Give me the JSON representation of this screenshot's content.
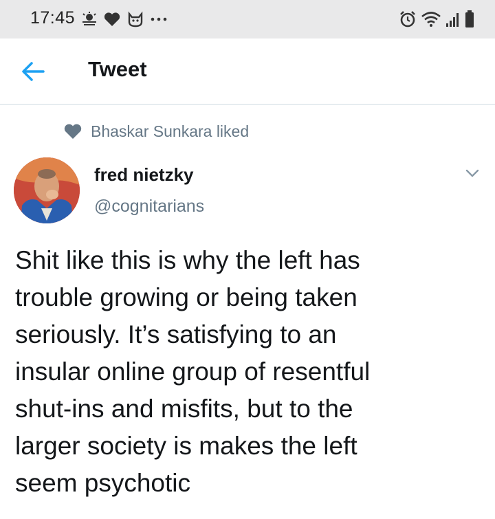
{
  "status_bar": {
    "time": "17:45",
    "icons_left": [
      "weather-icon",
      "heart-icon",
      "cat-icon",
      "more-dots-icon"
    ],
    "icons_right": [
      "alarm-icon",
      "wifi-icon",
      "signal-icon",
      "battery-icon"
    ]
  },
  "header": {
    "back_icon": "arrow-left-icon",
    "title": "Tweet"
  },
  "social_context": {
    "icon": "heart-icon",
    "text": "Bhaskar Sunkara liked"
  },
  "tweet": {
    "display_name": "fred nietzky",
    "handle": "@cognitarians",
    "text": "Shit like this is why the left has\ntrouble growing or being taken\nseriously. It’s satisfying to an\ninsular online group of resentful\nshut-ins and misfits, but to the\nlarger society is makes the left\nseem psychotic"
  },
  "colors": {
    "accent": "#1da1f2",
    "secondary_text": "#657786",
    "status_bar_bg": "#e9e9ea"
  }
}
